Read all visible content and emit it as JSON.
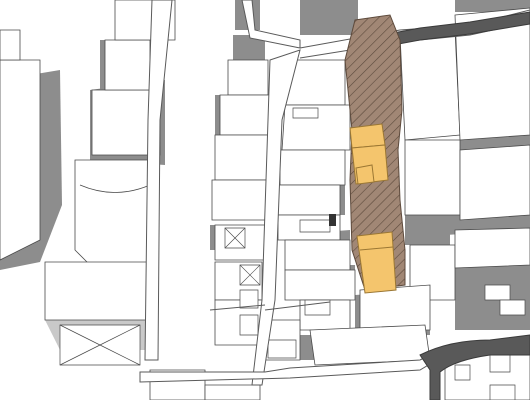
{
  "map": {
    "colors": {
      "background": "#ffffff",
      "building_fill": "#ffffff",
      "building_stroke": "#4a4a4a",
      "shadow": "#8d8d8d",
      "road_dark": "#595959",
      "highlight_zone_hatch": "#8b7361",
      "highlight_building": "#f4c56d"
    },
    "layers": [
      "buildings",
      "shadows",
      "roads",
      "hatched-zone",
      "highlighted-buildings"
    ]
  }
}
